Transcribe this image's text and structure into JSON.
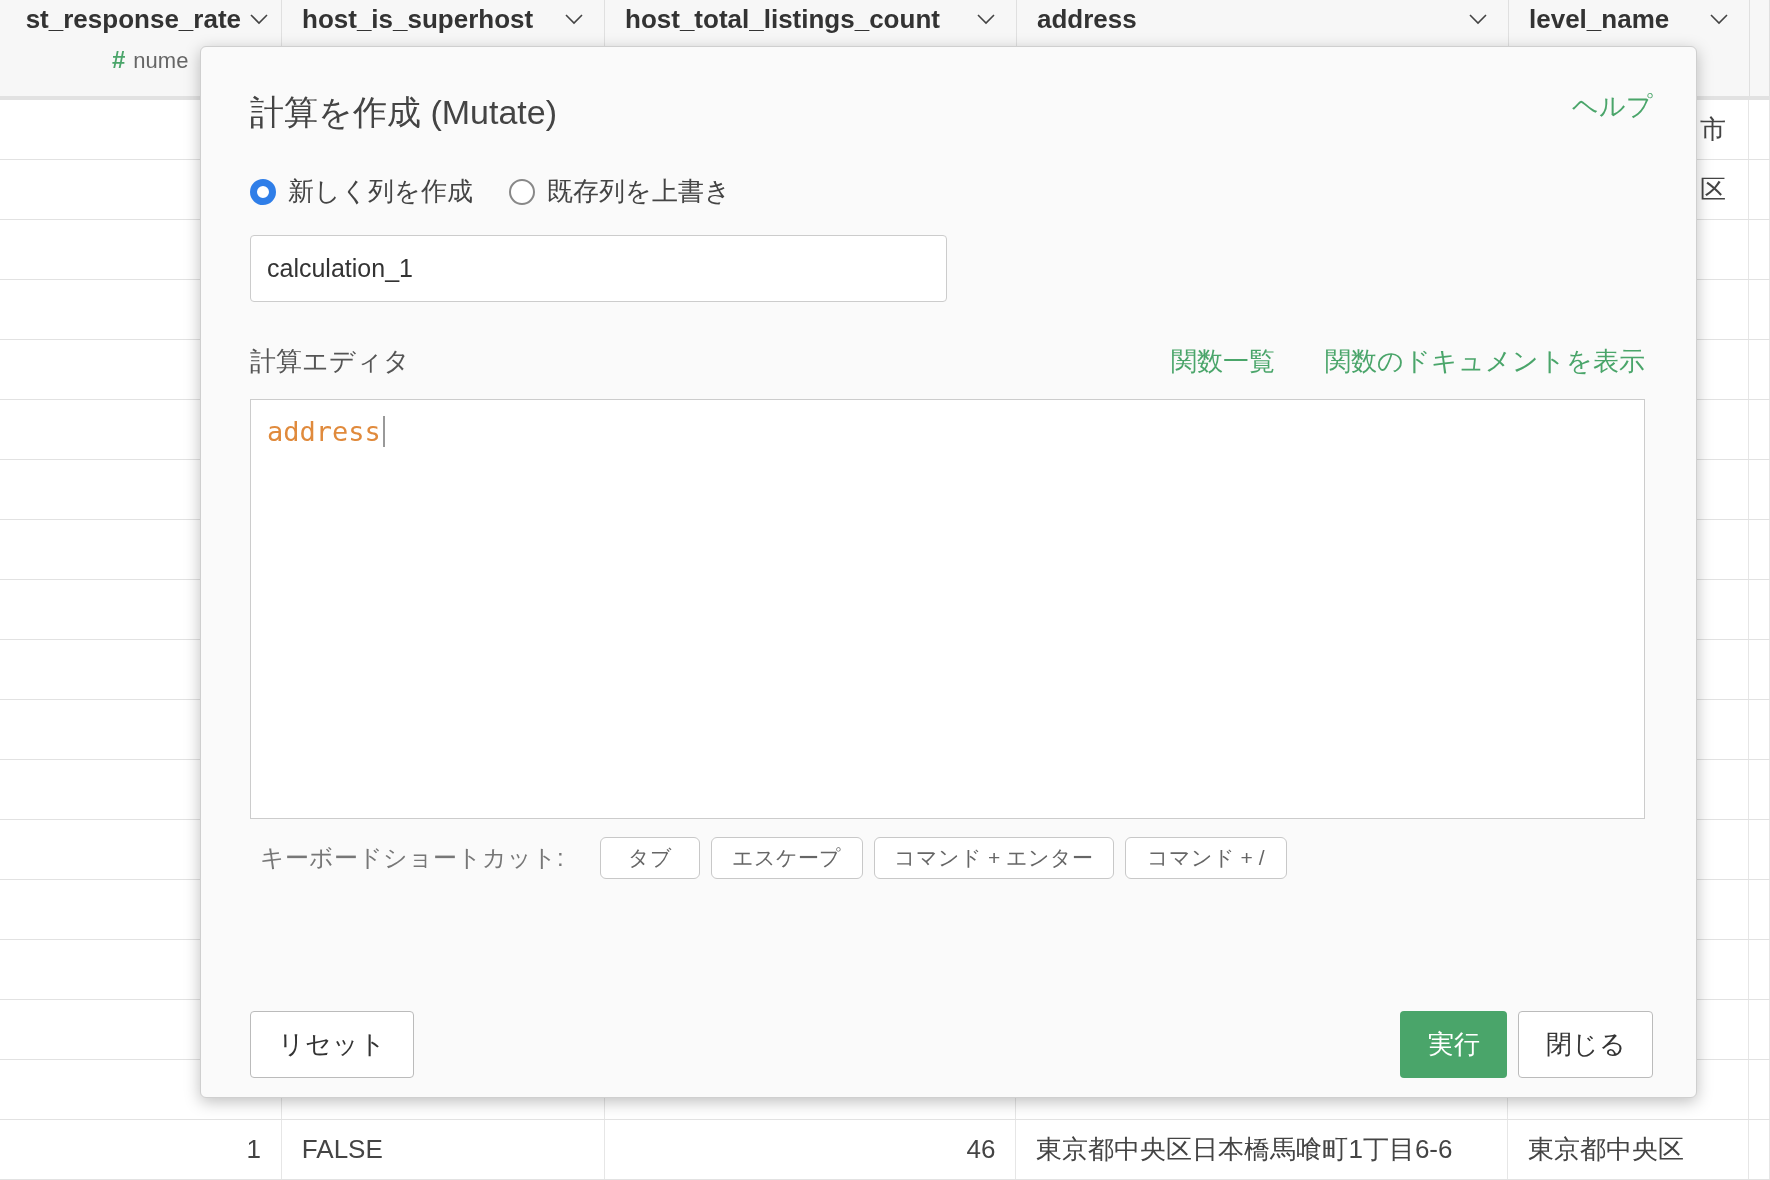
{
  "table": {
    "columns": [
      {
        "label": "st_response_rate",
        "type_icon": "#",
        "type_label": "nume"
      },
      {
        "label": "host_is_superhost"
      },
      {
        "label": "host_total_listings_count"
      },
      {
        "label": "address"
      },
      {
        "label": "level_name"
      }
    ],
    "edge_fragments": [
      "市",
      "区"
    ],
    "last_row": [
      "1",
      "FALSE",
      "46",
      "東京都中央区日本橋馬喰町1丁目6-6",
      "東京都中央区"
    ]
  },
  "dialog": {
    "title": "計算を作成 (Mutate)",
    "help_link": "ヘルプ",
    "modes": [
      {
        "label": "新しく列を作成",
        "selected": true
      },
      {
        "label": "既存列を上書き",
        "selected": false
      }
    ],
    "column_name": "calculation_1",
    "editor_label": "計算エディタ",
    "links": [
      "関数一覧",
      "関数のドキュメントを表示"
    ],
    "code": "address",
    "shortcuts_label": "キーボードショートカット:",
    "shortcuts": [
      "タブ",
      "エスケープ",
      "コマンド + エンター",
      "コマンド + /"
    ],
    "reset_button": "リセット",
    "run_button": "実行",
    "close_button": "閉じる"
  }
}
